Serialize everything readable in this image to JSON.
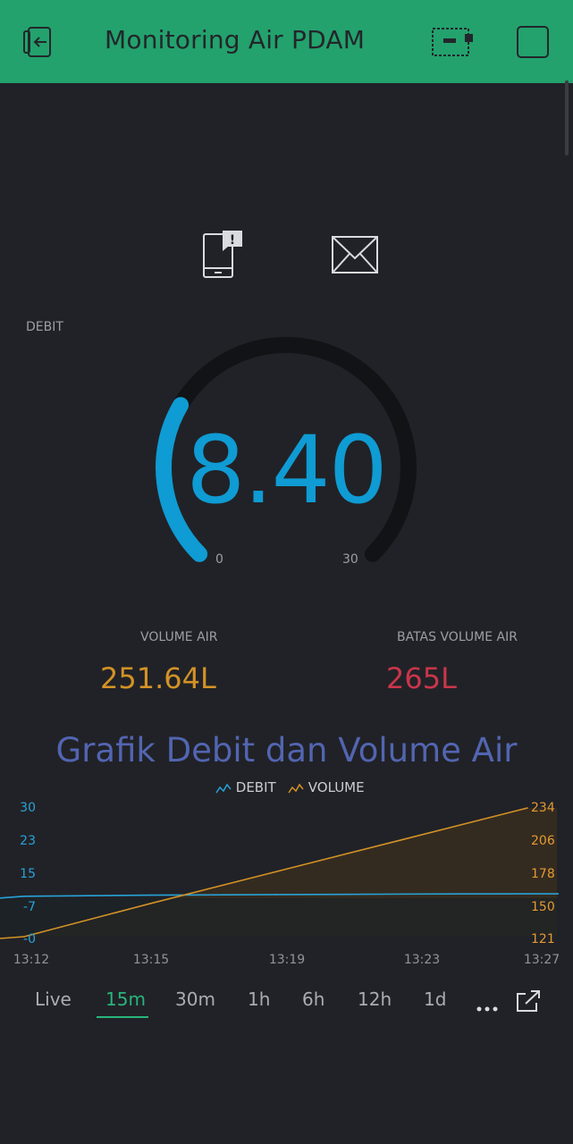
{
  "header": {
    "title": "Monitoring Air PDAM",
    "icons": [
      "exit-icon",
      "device-icon",
      "square-icon"
    ]
  },
  "notification_icons": [
    "phone-alert-icon",
    "mail-icon"
  ],
  "gauge": {
    "label": "DEBIT",
    "value": "8.40",
    "min": "0",
    "max": "30",
    "fraction": 0.28,
    "color": "#0f9bd3"
  },
  "volume": {
    "label": "VOLUME AIR",
    "value": "251.64L",
    "color": "#d39226"
  },
  "limit": {
    "label": "BATAS VOLUME AIR",
    "value": "265L",
    "color": "#c9354a"
  },
  "chart": {
    "title": "Grafik Debit dan Volume Air",
    "legend": {
      "debit": "DEBIT",
      "volume": "VOLUME"
    }
  },
  "chart_data": {
    "type": "line",
    "title": "Grafik Debit dan Volume Air",
    "x_ticks": [
      "13:12",
      "13:15",
      "13:19",
      "13:23",
      "13:27"
    ],
    "y_left_ticks": [
      "30",
      "23",
      "15",
      "-7",
      "-0"
    ],
    "y_right_ticks": [
      "234",
      "206",
      "178",
      "150",
      "121"
    ],
    "series": [
      {
        "name": "DEBIT",
        "axis": "left",
        "color": "#27a3d8",
        "x": [
          "13:12",
          "13:15",
          "13:19",
          "13:23",
          "13:27"
        ],
        "values": [
          7.5,
          7.9,
          8.1,
          8.3,
          8.4
        ]
      },
      {
        "name": "VOLUME",
        "axis": "right",
        "color": "#d39226",
        "x": [
          "13:12",
          "13:15",
          "13:19",
          "13:23",
          "13:27"
        ],
        "values": [
          121,
          150,
          178,
          206,
          234
        ]
      }
    ]
  },
  "ranges": {
    "items": [
      "Live",
      "15m",
      "30m",
      "1h",
      "6h",
      "12h",
      "1d"
    ],
    "active": "15m",
    "more_icon": "more-icon",
    "expand_icon": "expand-icon"
  }
}
